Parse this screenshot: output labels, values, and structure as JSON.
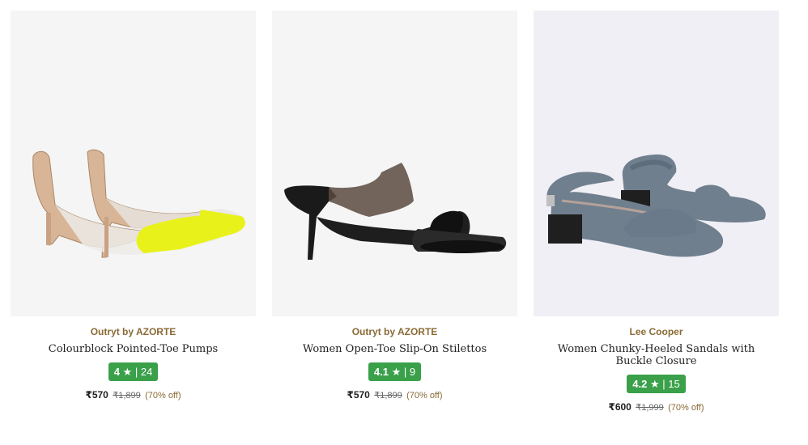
{
  "products": [
    {
      "brand": "Outryt by AZORTE",
      "title": "Colourblock Pointed-Toe Pumps",
      "rating": "4",
      "star": "★",
      "sep": "|",
      "reviews": "24",
      "price": "₹570",
      "mrp": "₹1,899",
      "discount": "(70% off)"
    },
    {
      "brand": "Outryt by AZORTE",
      "title": "Women Open-Toe Slip-On Stilettos",
      "rating": "4.1",
      "star": "★",
      "sep": "|",
      "reviews": "9",
      "price": "₹570",
      "mrp": "₹1,899",
      "discount": "(70% off)"
    },
    {
      "brand": "Lee Cooper",
      "title": "Women Chunky-Heeled Sandals with Buckle Closure",
      "rating": "4.2",
      "star": "★",
      "sep": "|",
      "reviews": "15",
      "price": "₹600",
      "mrp": "₹1,999",
      "discount": "(70% off)"
    }
  ],
  "colors": {
    "brand": "#8a6a35",
    "rating_badge": "#3aa04a",
    "image_bg": "#f5f5f5"
  }
}
